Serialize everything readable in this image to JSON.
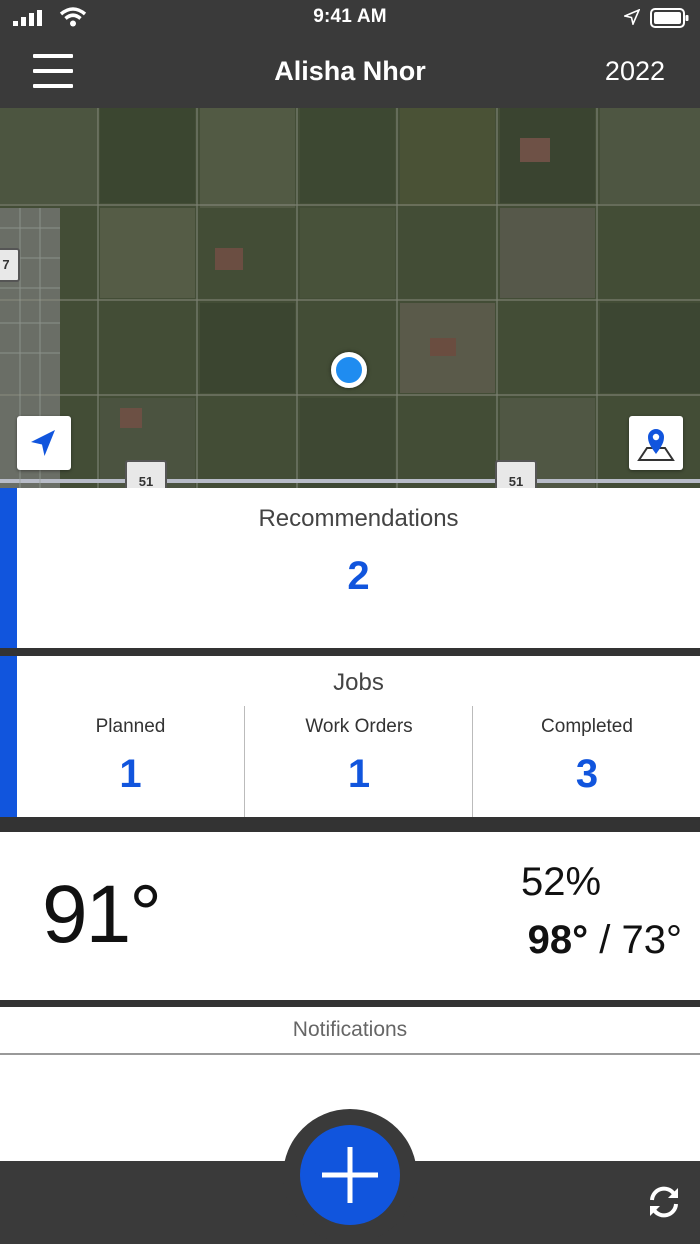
{
  "status_bar": {
    "time": "9:41 AM"
  },
  "header": {
    "title": "Alisha Nhor",
    "year": "2022"
  },
  "map": {
    "route_shield_left": "7",
    "route_shield_a": "51",
    "route_shield_b": "51"
  },
  "recommendations": {
    "title": "Recommendations",
    "count": "2"
  },
  "jobs": {
    "title": "Jobs",
    "columns": [
      {
        "label": "Planned",
        "value": "1"
      },
      {
        "label": "Work Orders",
        "value": "1"
      },
      {
        "label": "Completed",
        "value": "3"
      }
    ]
  },
  "weather": {
    "current_temp": "91°",
    "humidity": "52%",
    "high": "98°",
    "separator": " / ",
    "low": "73°"
  },
  "notifications": {
    "title": "Notifications"
  },
  "colors": {
    "accent": "#1155dd",
    "bar": "#3a3a3a",
    "location_dot": "#1f8cf0"
  },
  "icons": {
    "menu": "hamburger-icon",
    "recenter": "navigation-arrow-icon",
    "layers": "map-pin-icon",
    "add": "plus-icon",
    "sync": "refresh-icon"
  }
}
